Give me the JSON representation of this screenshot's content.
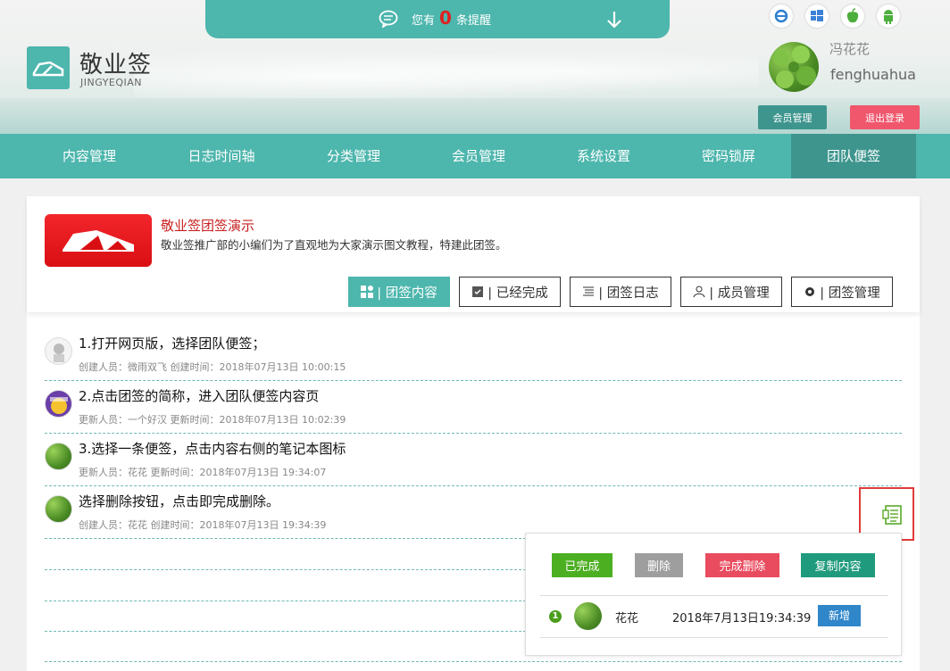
{
  "notice": {
    "prefix": "您有",
    "count": "0",
    "suffix": "条提醒"
  },
  "brand": {
    "title": "敬业签",
    "subtitle": "JINGYEQIAN"
  },
  "user": {
    "name_cn": "冯花花",
    "name_en": "fenghuahua"
  },
  "header_buttons": {
    "member": "会员管理",
    "logout": "退出登录"
  },
  "nav": [
    "内容管理",
    "日志时间轴",
    "分类管理",
    "会员管理",
    "系统设置",
    "密码锁屏",
    "团队便签"
  ],
  "team": {
    "name": "敬业签团签演示",
    "description": "敬业签推广部的小编们为了直观地为大家演示图文教程，特建此团签。"
  },
  "tabs": [
    "| 团签内容",
    "| 已经完成",
    "| 团签日志",
    "| 成员管理",
    "| 团签管理"
  ],
  "entries": [
    {
      "title": "1.打开网页版，选择团队便签；",
      "meta": "创建人员：微雨双飞 创建时间：2018年07月13日 10:00:15"
    },
    {
      "title": "2.点击团签的简称，进入团队便签内容页",
      "meta": "更新人员：一个好汉 更新时间：2018年07月13日 10:02:39"
    },
    {
      "title": "3.选择一条便签，点击内容右侧的笔记本图标",
      "meta": "更新人员：花花 更新时间：2018年07月13日 19:34:07"
    },
    {
      "title": "选择删除按钮，点击即完成删除。",
      "meta": "创建人员：花花 创建时间：2018年07月13日 19:34:39"
    }
  ],
  "popup": {
    "buttons": [
      "已完成",
      "删除",
      "完成删除",
      "复制内容"
    ],
    "record": {
      "index": "1",
      "name": "花花",
      "time": "2018年7月13日19:34:39",
      "tag": "新增"
    }
  },
  "colors": {
    "teal": "#4db6ad",
    "teal_dark": "#3e958e",
    "logout_pink": "#f0566c",
    "team_red": "#c81e1e"
  }
}
